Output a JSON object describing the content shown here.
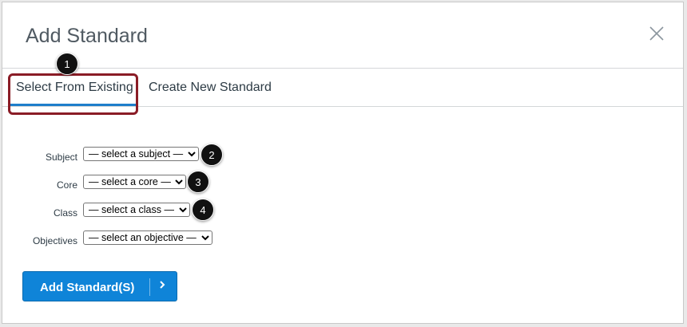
{
  "dialog": {
    "title": "Add Standard",
    "close_icon": "close-icon"
  },
  "tabs": [
    {
      "label": "Select From Existing",
      "active": true
    },
    {
      "label": "Create New Standard",
      "active": false
    }
  ],
  "form": {
    "subject": {
      "label": "Subject",
      "selected": "— select a subject —"
    },
    "core": {
      "label": "Core",
      "selected": "— select a core —"
    },
    "class": {
      "label": "Class",
      "selected": "— select a class —"
    },
    "objectives": {
      "label": "Objectives",
      "selected": "— select an objective —"
    }
  },
  "annotations": [
    "1",
    "2",
    "3",
    "4"
  ],
  "submit": {
    "label": "Add Standard(S)",
    "icon": "chevron-right-icon"
  },
  "colors": {
    "accent": "#0f84d8",
    "highlight": "#8a1c26",
    "tab_underline": "#1e7ecb"
  }
}
